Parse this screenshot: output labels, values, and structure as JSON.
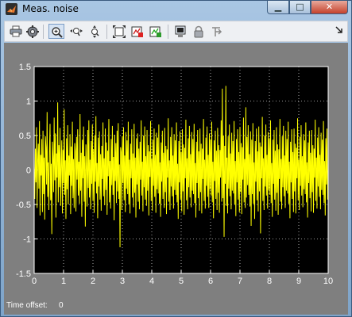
{
  "window": {
    "title": "Meas. noise",
    "controls": {
      "minimize": "▁",
      "maximize": "□",
      "close": "✕"
    }
  },
  "toolbar": {
    "buttons": [
      {
        "name": "print",
        "icon": "printer-icon"
      },
      {
        "name": "parameters",
        "icon": "gear-icon"
      },
      {
        "name": "zoom",
        "icon": "zoom-in-icon",
        "pressed": true
      },
      {
        "name": "zoom-x",
        "icon": "zoom-x-axis-icon"
      },
      {
        "name": "zoom-y",
        "icon": "zoom-y-axis-icon"
      },
      {
        "name": "autoscale",
        "icon": "autoscale-icon"
      },
      {
        "name": "save-axes",
        "icon": "save-axes-icon"
      },
      {
        "name": "restore-axes",
        "icon": "restore-axes-icon"
      },
      {
        "name": "floating-scope",
        "icon": "floating-scope-icon"
      },
      {
        "name": "lock-axes",
        "icon": "lock-icon"
      },
      {
        "name": "signal-selection",
        "icon": "signal-selection-icon"
      },
      {
        "name": "dock",
        "icon": "dock-arrow-icon"
      }
    ]
  },
  "status": {
    "time_offset_label": "Time offset:",
    "time_offset_value": "0"
  },
  "colors": {
    "plot_bg": "#000000",
    "trace": "#ffff00",
    "frame": "#7f7f7f",
    "grid": "#ffffff"
  },
  "chart_data": {
    "type": "line",
    "title": "",
    "xlabel": "",
    "ylabel": "",
    "xlim": [
      0,
      10
    ],
    "ylim": [
      -1.5,
      1.5
    ],
    "x_ticks": [
      "0",
      "1",
      "2",
      "3",
      "4",
      "5",
      "6",
      "7",
      "8",
      "9",
      "10"
    ],
    "y_ticks": [
      "1.5",
      "1",
      "0.5",
      "0",
      "-0.5",
      "-1",
      "-1.5"
    ],
    "grid": true,
    "series": [
      {
        "sample_time": 0.02,
        "values": [
          0.05,
          -0.42,
          0.31,
          -0.18,
          0.62,
          -0.55,
          0.12,
          0.38,
          -0.27,
          0.71,
          -0.66,
          0.22,
          -0.08,
          0.45,
          -0.61,
          0.57,
          -0.35,
          0.18,
          -0.72,
          0.49,
          0.33,
          -0.21,
          0.84,
          -0.39,
          0.11,
          -0.58,
          0.26,
          0.67,
          -0.44,
          0.09,
          -0.93,
          0.41,
          0.19,
          -0.32,
          0.76,
          -0.15,
          0.53,
          -0.69,
          0.24,
          -0.11,
          0.98,
          -0.47,
          0.36,
          -0.25,
          0.61,
          -0.52,
          0.07,
          0.43,
          -0.63,
          0.29,
          -0.19,
          0.88,
          -0.36,
          0.14,
          -0.71,
          0.46,
          -0.28,
          0.65,
          -0.5,
          0.21,
          -0.08,
          0.52,
          -0.64,
          0.34,
          -0.23,
          0.7,
          -0.41,
          0.16,
          -0.55,
          0.39,
          0.27,
          -0.6,
          0.48,
          -0.14,
          0.59,
          -0.37,
          0.12,
          -0.49,
          0.81,
          -0.3,
          0.25,
          -0.68,
          0.44,
          -0.12,
          0.63,
          -0.46,
          0.2,
          -0.82,
          0.37,
          0.06,
          -0.53,
          0.58,
          -0.26,
          0.72,
          -0.4,
          0.15,
          -0.57,
          0.42,
          -0.2,
          0.66,
          -0.45,
          0.3,
          -0.62,
          0.5,
          -0.17,
          0.78,
          -0.34,
          0.1,
          -0.7,
          0.47,
          -0.24,
          0.56,
          -0.43,
          0.23,
          -0.59,
          0.35,
          -0.13,
          0.69,
          -0.38,
          0.17,
          -0.51,
          0.6,
          -0.29,
          0.4,
          -0.65,
          0.28,
          -0.09,
          0.74,
          -0.47,
          0.13,
          -0.56,
          0.45,
          -0.22,
          0.64,
          -0.36,
          0.19,
          -0.73,
          0.51,
          -0.16,
          0.39,
          -0.48,
          0.57,
          -0.31,
          0.68,
          -0.42,
          0.08,
          -1.12,
          0.33,
          0.26,
          -0.58,
          0.49,
          -0.19,
          0.62,
          -0.44,
          0.21,
          -0.61,
          0.55,
          -0.27,
          0.43,
          -0.35,
          0.7,
          -0.5,
          0.15,
          -0.63,
          0.38,
          -0.12,
          0.59,
          -0.4,
          0.24,
          -0.54,
          0.67,
          -0.33,
          0.18,
          -0.69,
          0.46,
          -0.21,
          0.53,
          -0.46,
          0.31,
          -0.57,
          0.41,
          -0.14,
          0.72,
          -0.37,
          0.12,
          -0.6,
          0.5,
          -0.25,
          0.63,
          -0.43,
          0.2,
          -0.52,
          0.58,
          -0.3,
          0.36,
          -0.66,
          0.27,
          -0.1,
          0.71,
          -0.45,
          0.16,
          -0.59,
          0.44,
          -0.23,
          0.6,
          -0.39,
          0.22,
          -0.62,
          0.54,
          -0.28,
          0.47,
          -0.34,
          0.66,
          -0.49,
          0.11,
          -0.68,
          0.4,
          -0.17,
          0.57,
          -0.42,
          0.25,
          -0.55,
          0.61,
          -0.32,
          0.35,
          -0.64,
          0.3,
          -0.11,
          0.75,
          -0.46,
          0.14,
          -0.58,
          0.48,
          -0.24,
          0.62,
          -0.38,
          0.21,
          -0.56,
          0.52,
          -0.29,
          0.43,
          -0.36,
          0.69,
          -0.47,
          0.09,
          -0.71,
          0.42,
          -0.18,
          0.56,
          -0.43,
          0.26,
          -0.6,
          0.59,
          -0.31,
          0.37,
          -0.65,
          0.32,
          -0.12,
          0.73,
          -0.44,
          0.17,
          -0.57,
          0.46,
          -0.25,
          0.64,
          -0.4,
          0.23,
          -0.54,
          0.55,
          -0.3,
          0.45,
          -0.35,
          0.67,
          -0.48,
          0.1,
          -0.69,
          0.41,
          -0.19,
          0.58,
          -0.41,
          0.27,
          -0.59,
          0.6,
          -0.32,
          0.38,
          -0.63,
          0.31,
          -0.13,
          0.74,
          -0.45,
          0.15,
          -0.56,
          0.47,
          -0.23,
          0.63,
          -0.39,
          0.22,
          -0.55,
          0.53,
          -0.28,
          0.44,
          -0.37,
          0.7,
          -0.47,
          0.12,
          -0.7,
          0.43,
          -0.16,
          0.57,
          -0.42,
          0.28,
          -0.58,
          0.61,
          -0.33,
          0.36,
          -0.62,
          0.29,
          -0.11,
          0.72,
          -0.46,
          1.18,
          -0.41,
          0.5,
          -0.97,
          0.35,
          -0.2,
          1.22,
          -0.52,
          0.18,
          -0.63,
          0.49,
          -0.27,
          0.66,
          -0.38,
          0.24,
          -0.57,
          0.54,
          -0.3,
          0.42,
          -0.34,
          0.71,
          -0.5,
          0.13,
          -0.67,
          0.45,
          -0.18,
          0.59,
          -0.43,
          0.26,
          -0.61,
          0.62,
          -0.32,
          0.39,
          -0.64,
          0.33,
          -0.14,
          0.76,
          -0.47,
          0.16,
          -0.55,
          0.91,
          -0.4,
          0.48,
          -0.22,
          0.65,
          -0.36,
          0.23,
          -0.53,
          0.56,
          -0.81,
          0.44,
          -0.35,
          0.68,
          -0.49,
          0.11,
          -0.71,
          0.42,
          -0.17,
          0.6,
          -0.44,
          0.27,
          -0.6,
          0.63,
          -0.31,
          0.4,
          -0.92,
          0.34,
          -0.12,
          0.77,
          -0.45,
          0.17,
          -0.58,
          0.5,
          -0.24,
          0.66,
          -0.37,
          0.22,
          -0.56,
          0.55,
          -0.29,
          0.46,
          -0.36,
          0.72,
          -0.48,
          0.1,
          -0.68,
          0.44,
          -0.2,
          0.58,
          -0.43,
          0.28,
          -0.59,
          0.62,
          -0.33,
          0.37,
          -0.65,
          0.3,
          -0.13,
          0.74,
          -0.46,
          0.16,
          -0.57,
          0.49,
          -0.25,
          0.64,
          -0.38,
          0.21,
          -0.55,
          0.57,
          -0.3,
          0.45,
          -0.34,
          0.7,
          -0.49,
          0.12,
          -0.7,
          0.41,
          -0.18,
          0.59,
          -0.42,
          0.26,
          -0.61,
          0.6,
          -0.31,
          0.38,
          -0.63,
          0.32,
          -0.12,
          0.75,
          -0.44,
          0.15,
          -0.58,
          0.48,
          -0.23,
          0.65,
          -0.37,
          0.2,
          -0.54,
          0.52,
          -0.28,
          0.43,
          -0.35,
          0.69,
          -0.47,
          0.11,
          -0.69,
          0.4,
          -0.19,
          0.57,
          -0.41,
          0.25,
          -0.6,
          0.58,
          -0.32,
          0.36,
          -0.62,
          0.31,
          -0.11,
          0.73,
          -0.45,
          0.18,
          -0.56,
          0.47,
          -0.24,
          0.62,
          -0.39,
          0.22,
          -0.57,
          0.54,
          -0.29,
          0.44,
          -0.36,
          0.71,
          -0.48,
          0.13,
          -0.66,
          0.46,
          -0.21,
          0.6,
          -0.43,
          0.01
        ]
      }
    ]
  }
}
